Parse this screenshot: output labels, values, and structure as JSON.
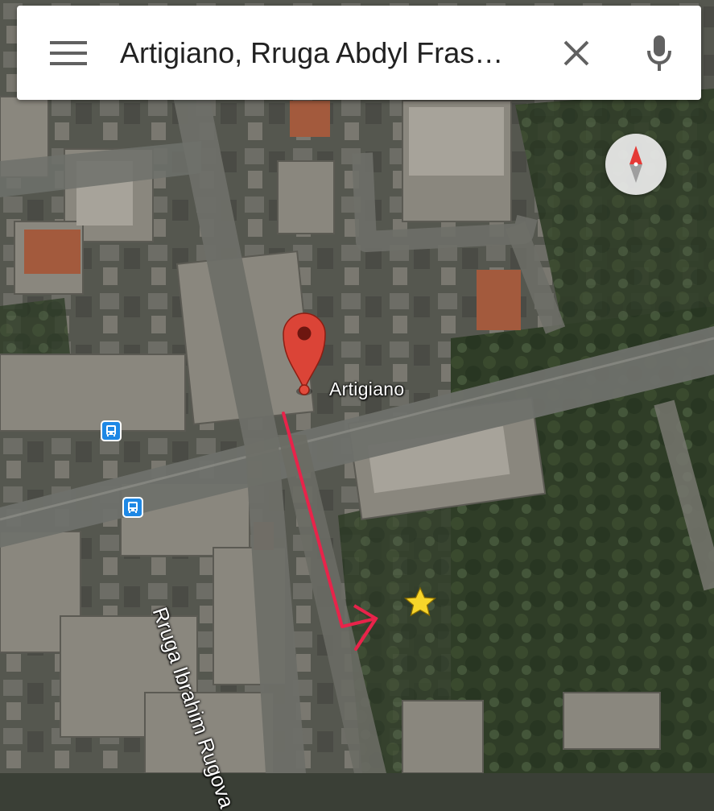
{
  "search": {
    "query": "Artigiano, Rruga Abdyl Fras…"
  },
  "map": {
    "view": "satellite",
    "place_name": "Artigiano",
    "street_name": "Rruga Ibrahim Rugova",
    "pin_color": "#db4437",
    "route_color": "#e8234a",
    "star_color": "#f7d52a",
    "bus_stop_color": "#1e88e5"
  },
  "icons": {
    "menu": "hamburger-menu-icon",
    "clear": "close-icon",
    "mic": "microphone-icon",
    "compass": "compass-icon",
    "pin": "map-pin-icon",
    "bus": "bus-stop-icon",
    "star": "star-icon"
  }
}
